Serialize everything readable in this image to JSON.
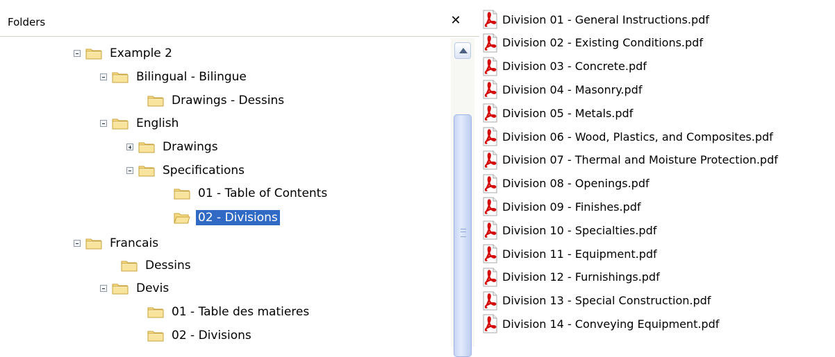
{
  "folders_pane": {
    "title": "Folders",
    "close_label": "✕",
    "tree": [
      {
        "label": "Example 2",
        "expander": "minus",
        "state": "closed",
        "level": 0
      },
      {
        "label": "Bilingual - Bilingue",
        "expander": "minus",
        "state": "closed",
        "level": 1
      },
      {
        "label": "Drawings - Dessins",
        "expander": "none",
        "state": "closed",
        "level": 2
      },
      {
        "label": "English",
        "expander": "minus",
        "state": "closed",
        "level": 1
      },
      {
        "label": "Drawings",
        "expander": "plus",
        "state": "closed",
        "level": 2
      },
      {
        "label": "Specifications",
        "expander": "minus",
        "state": "closed",
        "level": 2
      },
      {
        "label": "01 - Table of Contents",
        "expander": "none",
        "state": "closed",
        "level": 3
      },
      {
        "label": "02 - Divisions",
        "expander": "none",
        "state": "open",
        "level": 3,
        "selected": true
      },
      {
        "label": "Francais",
        "expander": "minus",
        "state": "closed",
        "level": 0
      },
      {
        "label": "Dessins",
        "expander": "none",
        "state": "closed",
        "level": 1
      },
      {
        "label": "Devis",
        "expander": "minus",
        "state": "closed",
        "level": 1
      },
      {
        "label": "01 - Table des matieres",
        "expander": "none",
        "state": "closed",
        "level": 2
      },
      {
        "label": "02 - Divisions",
        "expander": "none",
        "state": "closed",
        "level": 2
      }
    ]
  },
  "files_pane": {
    "items": [
      "Division 01 - General Instructions.pdf",
      "Division 02 - Existing Conditions.pdf",
      "Division 03 - Concrete.pdf",
      "Division 04 - Masonry.pdf",
      "Division 05 - Metals.pdf",
      "Division 06 - Wood, Plastics, and Composites.pdf",
      "Division 07 - Thermal and Moisture Protection.pdf",
      "Division 08 - Openings.pdf",
      "Division 09 - Finishes.pdf",
      "Division 10 - Specialties.pdf",
      "Division 11 - Equipment.pdf",
      "Division 12 - Furnishings.pdf",
      "Division 13 - Special Construction.pdf",
      "Division 14 - Conveying Equipment.pdf"
    ]
  },
  "icons": {
    "folder_closed": "folder-icon",
    "folder_open": "open-folder-icon",
    "pdf": "pdf-file-icon",
    "close": "close-icon",
    "scroll_up": "scroll-up-arrow-icon"
  },
  "colors": {
    "selection": "#316ac5",
    "folder": "#f4d879",
    "pdf_red": "#d50b0b"
  }
}
